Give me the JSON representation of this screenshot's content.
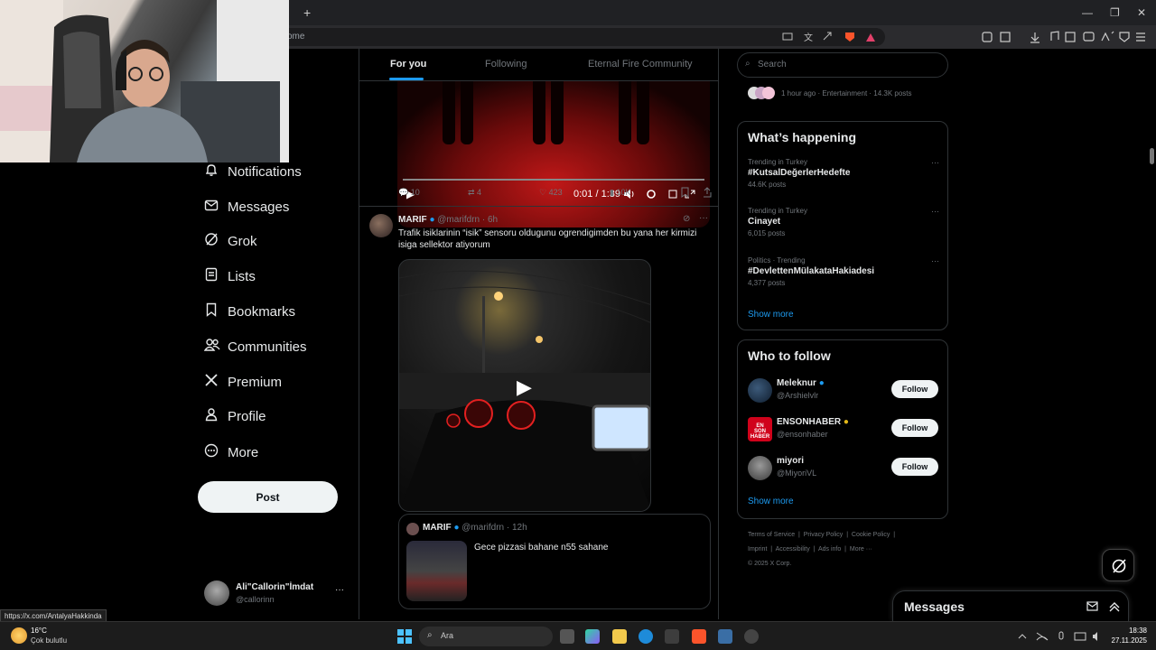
{
  "browser": {
    "new_tab_symbol": "+",
    "address_fragment": "ome",
    "window_controls": [
      "—",
      "❐",
      "✕"
    ]
  },
  "sidebar": {
    "items": [
      {
        "label": "Notifications",
        "icon": "bell-icon"
      },
      {
        "label": "Messages",
        "icon": "mail-icon"
      },
      {
        "label": "Grok",
        "icon": "grok-icon"
      },
      {
        "label": "Lists",
        "icon": "list-icon"
      },
      {
        "label": "Bookmarks",
        "icon": "bookmark-icon"
      },
      {
        "label": "Communities",
        "icon": "people-icon"
      },
      {
        "label": "Premium",
        "icon": "x-logo-icon"
      },
      {
        "label": "Profile",
        "icon": "person-icon"
      },
      {
        "label": "More",
        "icon": "more-circle-icon"
      }
    ],
    "post_label": "Post",
    "account": {
      "name": "Ali\"Callorin\"İmdat",
      "handle": "@callorinn",
      "more": "···"
    }
  },
  "feed": {
    "tabs": [
      "For you",
      "Following",
      "Eternal Fire Community"
    ],
    "video1": {
      "time": "0:01 / 1:39"
    },
    "post1_stats": {
      "replies": "10",
      "reposts": "4",
      "likes": "423",
      "views": "10K"
    },
    "post2": {
      "name": "MARIF",
      "handle": "@marifdrn",
      "time": "· 6h",
      "text": "Trafik isiklarinin “isik” sensoru oldugunu ogrendigimden bu yana her kirmizi isiga sellektor atiyorum"
    },
    "quote": {
      "name": "MARIF",
      "handle": "@marifdrn",
      "time": "· 12h",
      "text": "Gece pizzasi bahane n55 sahane"
    }
  },
  "right": {
    "search_placeholder": "Search",
    "top_trend_meta": "1 hour ago · Entertainment · 14.3K posts",
    "whats_happening": {
      "title": "What’s happening",
      "trends": [
        {
          "meta": "Trending in Turkey",
          "name": "#KutsalDeğerlerHedefte",
          "count": "44.6K posts"
        },
        {
          "meta": "Trending in Turkey",
          "name": "Cinayet",
          "count": "6,015 posts"
        },
        {
          "meta": "Politics · Trending",
          "name": "#DevlettenMülakataHakiadesi",
          "count": "4,377 posts"
        }
      ],
      "show_more": "Show more"
    },
    "who_to_follow": {
      "title": "Who to follow",
      "accounts": [
        {
          "name": "Meleknur",
          "handle": "@Arshielvlr",
          "badge": "#1d9bf0"
        },
        {
          "name": "ENSONHABER",
          "handle": "@ensonhaber",
          "badge": "#e2b719"
        },
        {
          "name": "miyori",
          "handle": "@MiyoriVL",
          "badge": ""
        }
      ],
      "follow_label": "Follow",
      "show_more": "Show more"
    },
    "footer": {
      "line1": [
        "Terms of Service",
        "Privacy Policy",
        "Cookie Policy"
      ],
      "line2": [
        "Imprint",
        "Accessibility",
        "Ads info",
        "More ···"
      ],
      "copyright": "© 2025 X Corp."
    },
    "messages_dock": "Messages"
  },
  "status_link": "https://x.com/AntalyaHakkinda",
  "taskbar": {
    "weather_temp": "16°C",
    "weather_desc": "Çok bulutlu",
    "search_label": "Ara",
    "time": "18:38",
    "date": "27.11.2025"
  },
  "colors": {
    "accent": "#1d9bf0",
    "border": "#2f3336",
    "muted": "#71767b"
  }
}
